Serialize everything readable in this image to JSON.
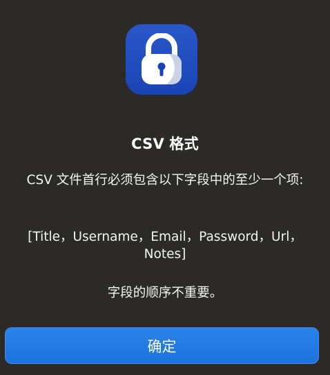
{
  "dialog": {
    "app_icon": "lock-icon",
    "title": "CSV 格式",
    "message_line1": "CSV 文件首行必须包含以下字段中的至少一个项:",
    "message_line2": "[Title，Username，Email，Password，Url，Notes]",
    "message_line3": "字段的顺序不重要。",
    "confirm_label": "确定"
  },
  "colors": {
    "background": "#2c2a27",
    "icon_background": "#1f4bbd",
    "button_background": "#2379e3",
    "text": "#ffffff"
  }
}
